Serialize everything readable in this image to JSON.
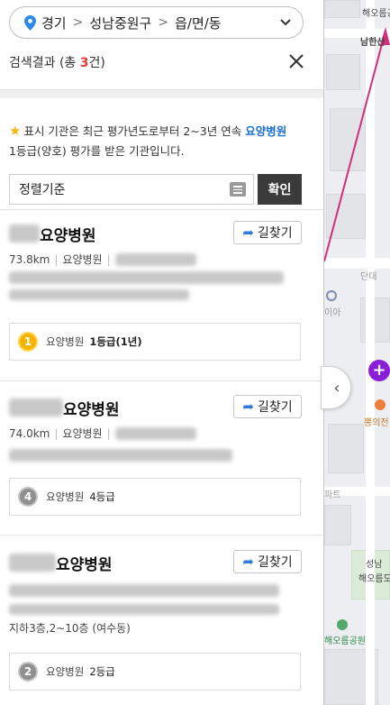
{
  "region": {
    "level1": "경기",
    "level2": "성남중원구",
    "level3": "읍/면/동"
  },
  "results": {
    "label_prefix": "검색결과 (총 ",
    "count": "3",
    "label_suffix": "건)"
  },
  "notice": {
    "text_before": "표시 기관은 최근 평가년도로부터 2~3년 연속 ",
    "highlight": "요양병원",
    "text_after": "1등급(양호) 평가를 받은 기관입니다."
  },
  "sort": {
    "selected": "정렬기준",
    "confirm_label": "확인"
  },
  "route_label": "길찾기",
  "hospitals": [
    {
      "name_visible": "요양병원",
      "distance": "73.8km",
      "type": "요양병원",
      "grade_medal": "1",
      "grade_type": "요양병원",
      "grade_level": "1등급(1년)"
    },
    {
      "name_visible": "요양병원",
      "distance": "74.0km",
      "type": "요양병원",
      "grade_medal": "4",
      "grade_type": "요양병원",
      "grade_level": "4등급"
    },
    {
      "name_visible": "요양병원",
      "address_line2": "지하3층,2~10층 (여수동)",
      "grade_medal": "2",
      "grade_type": "요양병원",
      "grade_level": "2등급"
    }
  ],
  "map": {
    "labels": [
      "남한산",
      "단대",
      "뽕의전",
      "파트",
      "성남",
      "해오름도",
      "해오름공원",
      "이아"
    ]
  },
  "colors": {
    "accent_blue": "#1a6fd1",
    "count_red": "#e53935",
    "confirm_bg": "#3b3b3b",
    "gold_medal": "#f5b400",
    "gray_medal": "#8f8f8f",
    "map_pin_purple": "#8b1fd6"
  },
  "icons": {
    "location": "location-pin-icon",
    "breadcrumb_sep": "chevron-right-icon",
    "dropdown": "chevron-down-icon",
    "close": "close-icon",
    "star": "star-icon",
    "list": "list-icon",
    "route": "route-arrow-icon",
    "collapse": "chevron-left-icon"
  }
}
